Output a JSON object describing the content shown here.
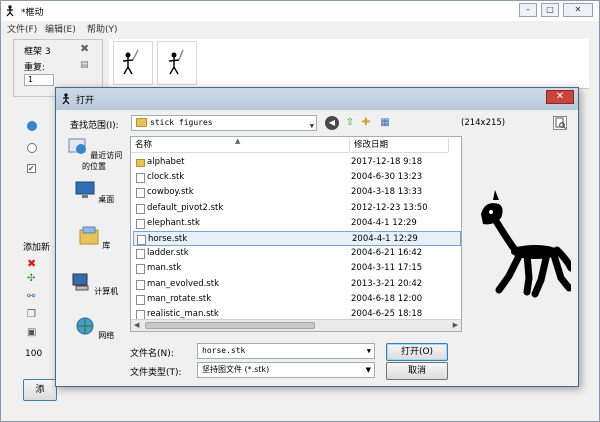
{
  "main_window": {
    "title": "*框动",
    "menus": [
      "文件(F)",
      "编辑(E)",
      "帮助(Y)"
    ],
    "frame_label": "框架 3",
    "repeat_label": "重复:",
    "repeat_value": "1",
    "left_labels": [
      "添加新",
      "100"
    ],
    "bottom_button": "添"
  },
  "dialog": {
    "title": "打开",
    "look_in_label": "查找范围(I):",
    "look_in_value": "stick figures",
    "places": [
      "最近访问的位置",
      "桌面",
      "库",
      "计算机",
      "网络"
    ],
    "columns": [
      "名称",
      "修改日期"
    ],
    "files": [
      {
        "name": "alphabet",
        "date": "2017-12-18 9:18",
        "folder": true
      },
      {
        "name": "clock.stk",
        "date": "2004-6-30 13:23",
        "folder": false
      },
      {
        "name": "cowboy.stk",
        "date": "2004-3-18 13:33",
        "folder": false
      },
      {
        "name": "default_pivot2.stk",
        "date": "2012-12-23 13:50",
        "folder": false
      },
      {
        "name": "elephant.stk",
        "date": "2004-4-1 12:29",
        "folder": false
      },
      {
        "name": "horse.stk",
        "date": "2004-4-1 12:29",
        "folder": false,
        "selected": true
      },
      {
        "name": "ladder.stk",
        "date": "2004-6-21 16:42",
        "folder": false
      },
      {
        "name": "man.stk",
        "date": "2004-3-11 17:15",
        "folder": false
      },
      {
        "name": "man_evolved.stk",
        "date": "2013-3-21 20:42",
        "folder": false
      },
      {
        "name": "man_rotate.stk",
        "date": "2004-6-18 12:00",
        "folder": false
      },
      {
        "name": "realistic_man.stk",
        "date": "2004-6-25 18:18",
        "folder": false
      }
    ],
    "preview_size": "(214x215)",
    "filename_label": "文件名(N):",
    "filename_value": "horse.stk",
    "filetype_label": "文件类型(T):",
    "filetype_value": "坚持图文件 (*.stk)",
    "open_button": "打开(O)",
    "cancel_button": "取消"
  }
}
